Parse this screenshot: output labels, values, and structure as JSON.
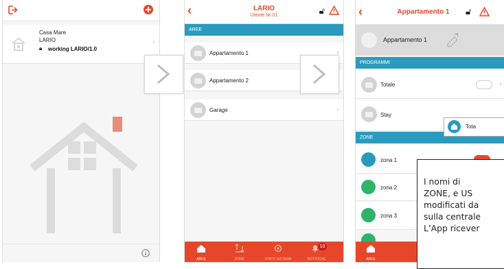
{
  "screen1": {
    "site_name": "Casa Mare",
    "site_sub": "LARIO",
    "site_status": "working LARIO/1.0",
    "info_icon": "info-icon"
  },
  "screen2": {
    "title": "LARIO",
    "subtitle": "Utente Nr 01",
    "section": "AREE",
    "areas": [
      {
        "label": "Appartamento 1"
      },
      {
        "label": "Appartamento 2"
      },
      {
        "label": "Garage"
      }
    ],
    "tabs": [
      {
        "label": "AREE",
        "icon": "home-icon"
      },
      {
        "label": "ZONE",
        "icon": "zones-icon"
      },
      {
        "label": "STATO SISTEMA",
        "icon": "status-icon"
      },
      {
        "label": "NOTIFICHE",
        "icon": "bell-icon",
        "badge": "10"
      }
    ]
  },
  "screen3": {
    "title": "Appartamento 1",
    "area_name": "Appartamento 1",
    "programs_section": "PROGRAMMI",
    "programs": [
      {
        "label": "Totale",
        "on": false
      },
      {
        "label": "Stay",
        "on": false
      }
    ],
    "zones_section": "ZONE",
    "zones": [
      {
        "label": "zona 1",
        "on": true,
        "icon": "camera-icon"
      },
      {
        "label": "zona 2",
        "icon": "motion-icon"
      },
      {
        "label": "zona 3",
        "icon": "motion-icon"
      }
    ],
    "tab_label": "AREE",
    "popup_label": "Tota"
  },
  "note_lines": [
    "I   nomi   di",
    "ZONE,  e  US",
    "modificati  da",
    "sulla centrale",
    "L’App  ricever"
  ],
  "colors": {
    "accent": "#e8462a",
    "section": "#2a9bbe"
  }
}
